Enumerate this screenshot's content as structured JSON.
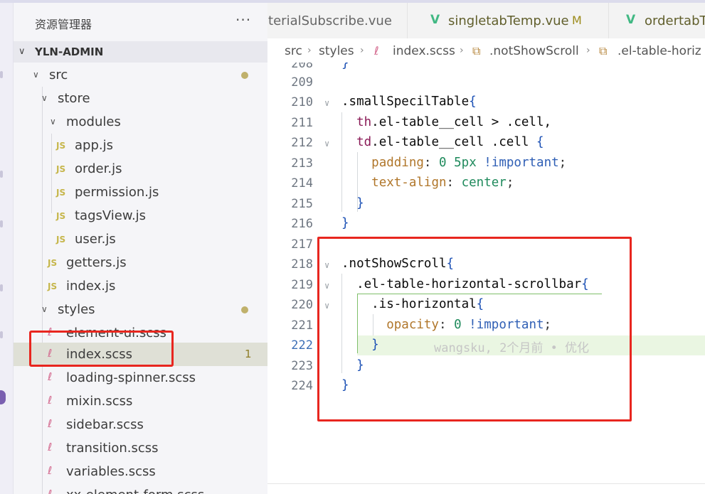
{
  "sidebar": {
    "title": "资源管理器",
    "more": "···",
    "project": "YLN-ADMIN",
    "tree": [
      {
        "name": "src",
        "kind": "folder",
        "depth": 1,
        "expanded": true,
        "modified_dot": true
      },
      {
        "name": "store",
        "kind": "folder",
        "depth": 2,
        "expanded": true
      },
      {
        "name": "modules",
        "kind": "folder",
        "depth": 3,
        "expanded": true
      },
      {
        "name": "app.js",
        "kind": "js",
        "depth": 4
      },
      {
        "name": "order.js",
        "kind": "js",
        "depth": 4
      },
      {
        "name": "permission.js",
        "kind": "js",
        "depth": 4
      },
      {
        "name": "tagsView.js",
        "kind": "js",
        "depth": 4
      },
      {
        "name": "user.js",
        "kind": "js",
        "depth": 4
      },
      {
        "name": "getters.js",
        "kind": "js",
        "depth": 3
      },
      {
        "name": "index.js",
        "kind": "js",
        "depth": 3
      },
      {
        "name": "styles",
        "kind": "folder",
        "depth": 2,
        "expanded": true,
        "modified_dot": true
      },
      {
        "name": "element-ui.scss",
        "kind": "scss",
        "depth": 3
      },
      {
        "name": "index.scss",
        "kind": "scss",
        "depth": 3,
        "selected": true,
        "problems": "1"
      },
      {
        "name": "loading-spinner.scss",
        "kind": "scss",
        "depth": 3
      },
      {
        "name": "mixin.scss",
        "kind": "scss",
        "depth": 3
      },
      {
        "name": "sidebar.scss",
        "kind": "scss",
        "depth": 3
      },
      {
        "name": "transition.scss",
        "kind": "scss",
        "depth": 3
      },
      {
        "name": "variables.scss",
        "kind": "scss",
        "depth": 3
      },
      {
        "name": "xx-element-form.scss",
        "kind": "scss",
        "depth": 3
      }
    ]
  },
  "tabs": [
    {
      "label": "aterialSubscribe.vue",
      "modified": "",
      "icon": "vue-icon"
    },
    {
      "label": "singletabTemp.vue",
      "modified": "M",
      "icon": "vue-icon"
    },
    {
      "label": "ordertabTe",
      "modified": "",
      "icon": "vue-icon"
    }
  ],
  "breadcrumb": {
    "parts": [
      "src",
      "styles",
      "index.scss",
      ".notShowScroll",
      ".el-table-horiz"
    ],
    "sep": "›"
  },
  "editor": {
    "active_line": 222,
    "blame": "wangsku, 2个月前 • 优化",
    "lines": [
      {
        "n": 208,
        "code": "}"
      },
      {
        "n": 209,
        "code": ""
      },
      {
        "n": 210,
        "code": ".smallSpecilTable{"
      },
      {
        "n": 211,
        "code": "  th.el-table__cell > .cell,"
      },
      {
        "n": 212,
        "code": "  td.el-table__cell .cell {"
      },
      {
        "n": 213,
        "code": "    padding: 0 5px !important;"
      },
      {
        "n": 214,
        "code": "    text-align: center;"
      },
      {
        "n": 215,
        "code": "  }"
      },
      {
        "n": 216,
        "code": "}"
      },
      {
        "n": 217,
        "code": ""
      },
      {
        "n": 218,
        "code": ".notShowScroll{"
      },
      {
        "n": 219,
        "code": "  .el-table-horizontal-scrollbar{"
      },
      {
        "n": 220,
        "code": "    .is-horizontal{"
      },
      {
        "n": 221,
        "code": "      opacity: 0 !important;"
      },
      {
        "n": 222,
        "code": "    }"
      },
      {
        "n": 223,
        "code": "  }"
      },
      {
        "n": 224,
        "code": "}"
      }
    ]
  },
  "colors": {
    "annotation_red": "#e8261f",
    "selected_row": "#dfe0d6",
    "active_line_bg": "#eaf6e2",
    "vue_green": "#41b883",
    "sass_pink": "#d46a8f",
    "js_yellow": "#c6b64b"
  }
}
